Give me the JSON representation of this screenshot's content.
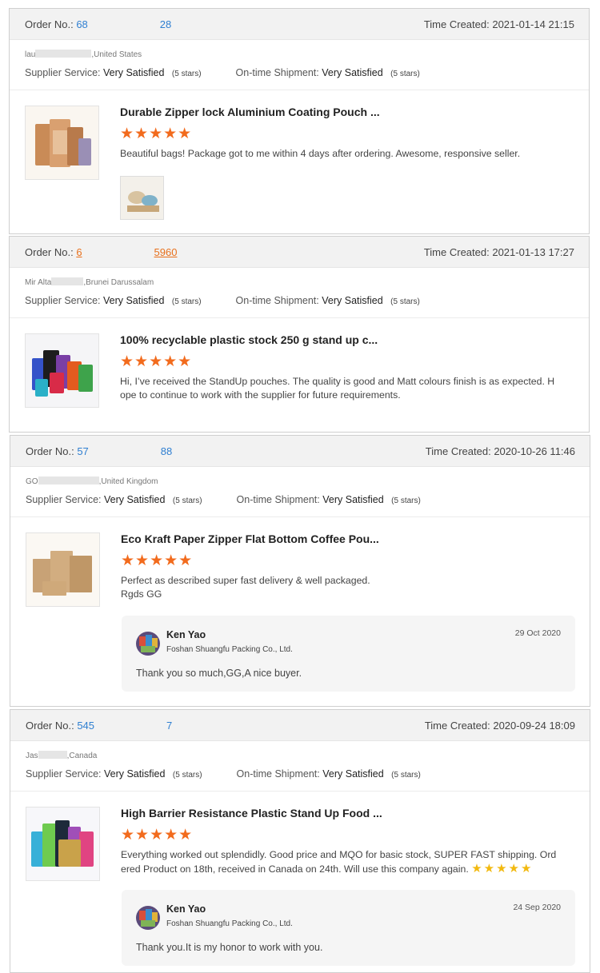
{
  "labels": {
    "order_no": "Order No.:",
    "time_created": "Time Created:",
    "supplier_service": "Supplier Service:",
    "on_time_shipment": "On-time Shipment:"
  },
  "reviews": [
    {
      "order_start": "68",
      "order_end": "28",
      "time": "2021-01-14 21:15",
      "buyer_start": "lau",
      "buyer_country": ",United States",
      "supplier_rating": "Very Satisfied",
      "supplier_stars": "(5 stars)",
      "shipment_rating": "Very Satisfied",
      "shipment_stars": "(5 stars)",
      "product_title": "Durable Zipper lock Aluminium Coating Pouch ...",
      "stars": "★★★★★",
      "rating": 5,
      "text": "Beautiful bags! Package got to me within 4 days after ordering. Awesome, responsive seller."
    },
    {
      "order_start": "6",
      "order_end": "5960",
      "time": "2021-01-13 17:27",
      "buyer_start": "Mir Alta",
      "buyer_country": ",Brunei Darussalam",
      "supplier_rating": "Very Satisfied",
      "supplier_stars": "(5 stars)",
      "shipment_rating": "Very Satisfied",
      "shipment_stars": "(5 stars)",
      "product_title": "100% recyclable plastic stock 250 g stand up c...",
      "stars": "★★★★★",
      "rating": 5,
      "text_line1": "Hi, I’ve received the StandUp pouches. The quality is good and Matt colours finish is as expected. H",
      "text_line2": "ope to continue to work with the supplier for future requirements."
    },
    {
      "order_start": "57",
      "order_end": "88",
      "time": "2020-10-26 11:46",
      "buyer_start": "GO",
      "buyer_country": ",United Kingdom",
      "supplier_rating": "Very Satisfied",
      "supplier_stars": "(5 stars)",
      "shipment_rating": "Very Satisfied",
      "shipment_stars": "(5 stars)",
      "product_title": "Eco Kraft Paper Zipper Flat Bottom Coffee Pou...",
      "stars": "★★★★★",
      "rating": 5,
      "text_line1": "Perfect as described super fast delivery & well packaged.",
      "text_line2": "Rgds GG",
      "reply": {
        "name": "Ken Yao",
        "company": "Foshan Shuangfu Packing Co., Ltd.",
        "date": "29 Oct 2020",
        "text": "Thank you so much,GG,A nice buyer."
      }
    },
    {
      "order_start": "545",
      "order_end": "7",
      "time": "2020-09-24 18:09",
      "buyer_start": "Jas",
      "buyer_country": ",Canada",
      "supplier_rating": "Very Satisfied",
      "supplier_stars": "(5 stars)",
      "shipment_rating": "Very Satisfied",
      "shipment_stars": "(5 stars)",
      "product_title": "High Barrier Resistance Plastic Stand Up Food ...",
      "stars": "★★★★★",
      "rating": 5,
      "text_line1": "Everything worked out splendidly.  Good price and MQO for basic stock, SUPER FAST shipping.  Ord",
      "text_line2": "ered Product on 18th, received in Canada on 24th.  Will use this company again.",
      "inline_stars": "★★★★★",
      "reply": {
        "name": "Ken Yao",
        "company": "Foshan Shuangfu Packing Co., Ltd.",
        "date": "24 Sep 2020",
        "text": "Thank you.It is my honor to work with you."
      }
    }
  ],
  "colors": {
    "accent_orange": "#f26b1d",
    "link_blue": "#2f7fd1",
    "header_bg": "#f2f2f2"
  }
}
